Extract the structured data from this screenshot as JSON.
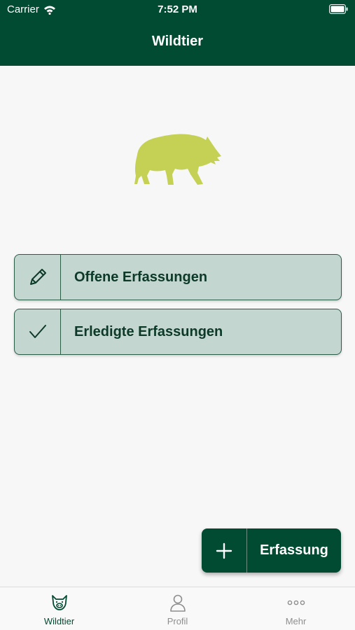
{
  "status_bar": {
    "carrier": "Carrier",
    "time": "7:52 PM"
  },
  "nav": {
    "title": "Wildtier"
  },
  "menu": [
    {
      "label": "Offene Erfassungen",
      "icon": "pencil-icon"
    },
    {
      "label": "Erledigte Erfassungen",
      "icon": "checkmark-icon"
    }
  ],
  "fab": {
    "label": "Erfassung",
    "icon": "plus-icon"
  },
  "tabbar": {
    "items": [
      {
        "label": "Wildtier",
        "icon": "boar-head-icon",
        "active": true
      },
      {
        "label": "Profil",
        "icon": "person-icon",
        "active": false
      },
      {
        "label": "Mehr",
        "icon": "ellipsis-icon",
        "active": false
      }
    ]
  },
  "colors": {
    "primary": "#024b33",
    "button_fill": "#c3d6d0",
    "illustration": "#c5d155",
    "inactive_tab": "#8e8e8e"
  }
}
